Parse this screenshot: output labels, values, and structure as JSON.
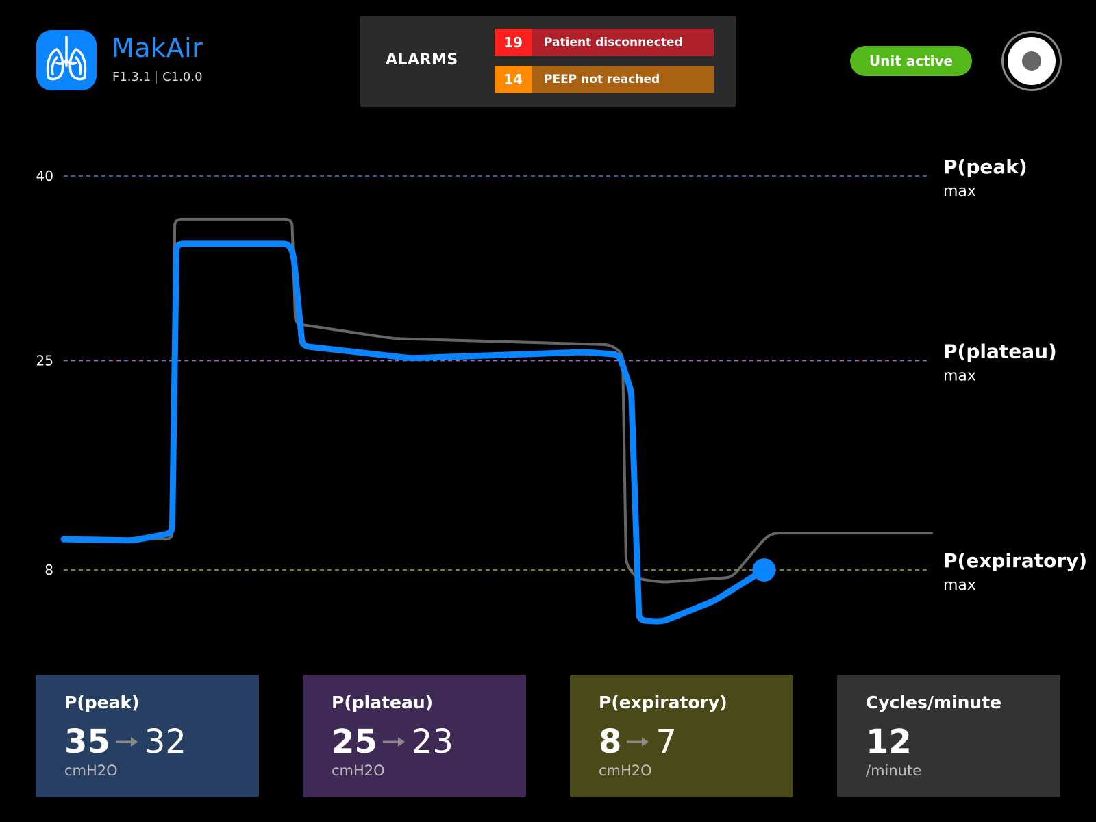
{
  "brand": {
    "name": "MakAir",
    "firmware": "F1.3.1",
    "control": "C1.0.0",
    "logo_icon": "lungs-icon",
    "color": "#1e90ff"
  },
  "alarms": {
    "title": "ALARMS",
    "items": [
      {
        "code": "19",
        "message": "Patient disconnected",
        "color": "#ff2020"
      },
      {
        "code": "14",
        "message": "PEEP not reached",
        "color": "#ff8a00"
      }
    ]
  },
  "status": {
    "label": "Unit active",
    "color": "#55b81a"
  },
  "power": {
    "icon": "power-record-icon"
  },
  "chart_data": {
    "type": "line",
    "title": "",
    "xlabel": "",
    "ylabel": "",
    "ylim": [
      2,
      44
    ],
    "yticks": [
      40,
      25,
      8
    ],
    "thresholds": [
      {
        "value": 40,
        "label": "P(peak)",
        "sub": "max",
        "color": "#4a7bc8"
      },
      {
        "value": 25,
        "label": "P(plateau)",
        "sub": "max",
        "color": "#9a6ac8"
      },
      {
        "value": 8,
        "label": "P(expiratory)",
        "sub": "max",
        "color": "#a8a84a"
      }
    ],
    "series": [
      {
        "color": "#888888",
        "x": [
          0,
          12.5,
          12.8,
          26.3,
          26.7,
          38,
          63,
          64.4,
          64.8,
          66,
          69,
          77,
          80.7,
          81.7,
          100
        ],
        "values": [
          10.5,
          10.5,
          36.5,
          36.5,
          28,
          26.8,
          26.3,
          25.6,
          8.5,
          7.3,
          7.0,
          7.4,
          10.5,
          11.0,
          11.0
        ]
      },
      {
        "color": "#0a84ff",
        "x": [
          0,
          8,
          12.5,
          13.0,
          26.0,
          26.5,
          27.5,
          40,
          60,
          64,
          65.4,
          66.3,
          69,
          75,
          80.7
        ],
        "values": [
          10.5,
          10.4,
          11.0,
          34.5,
          34.5,
          33.5,
          26.2,
          25.2,
          25.7,
          25.5,
          22.5,
          3.9,
          3.8,
          5.5,
          8.0
        ]
      }
    ]
  },
  "cards": [
    {
      "label": "P(peak)",
      "value": "35",
      "target": "32",
      "unit": "cmH2O",
      "color": "#263f63"
    },
    {
      "label": "P(plateau)",
      "value": "25",
      "target": "23",
      "unit": "cmH2O",
      "color": "#3f2a56"
    },
    {
      "label": "P(expiratory)",
      "value": "8",
      "target": "7",
      "unit": "cmH2O",
      "color": "#4a4a19"
    },
    {
      "label": "Cycles/minute",
      "value": "12",
      "unit": "/minute",
      "color": "#333333"
    }
  ]
}
